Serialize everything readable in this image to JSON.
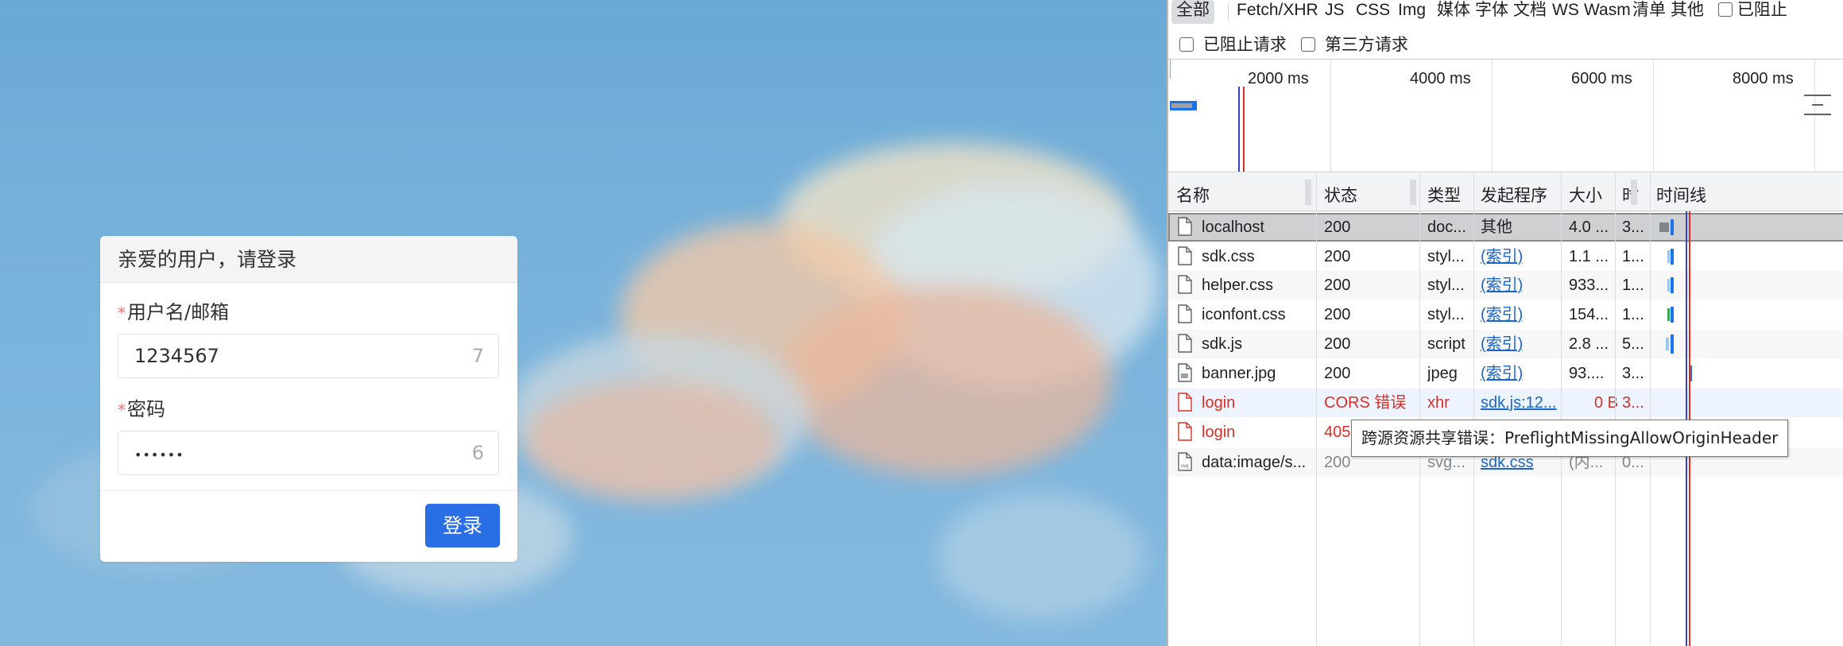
{
  "login": {
    "title": "亲爱的用户，请登录",
    "username_label": "用户名/邮箱",
    "username_value": "1234567",
    "username_count": "7",
    "password_label": "密码",
    "password_value": "••••••",
    "password_count": "6",
    "required_mark": "*",
    "submit_label": "登录"
  },
  "devtools": {
    "filters": [
      "全部",
      "Fetch/XHR",
      "JS",
      "CSS",
      "Img",
      "媒体",
      "字体",
      "文档",
      "WS",
      "Wasm",
      "清单",
      "其他"
    ],
    "blocked_response_cookies": "已阻止",
    "blocked_requests": "已阻止请求",
    "third_party": "第三方请求",
    "timeline_labels": [
      "2000 ms",
      "4000 ms",
      "6000 ms",
      "8000 ms"
    ],
    "columns": [
      "名称",
      "状态",
      "类型",
      "发起程序",
      "大小",
      "时",
      "时间线"
    ],
    "rows": [
      {
        "name": "localhost",
        "status": "200",
        "type": "doc...",
        "initiator": "其他",
        "size": "4.0 ...",
        "time": "3..."
      },
      {
        "name": "sdk.css",
        "status": "200",
        "type": "styl...",
        "initiator": "(索引)",
        "size": "1.1 ...",
        "time": "1..."
      },
      {
        "name": "helper.css",
        "status": "200",
        "type": "styl...",
        "initiator": "(索引)",
        "size": "933...",
        "time": "1..."
      },
      {
        "name": "iconfont.css",
        "status": "200",
        "type": "styl...",
        "initiator": "(索引)",
        "size": "154...",
        "time": "1..."
      },
      {
        "name": "sdk.js",
        "status": "200",
        "type": "script",
        "initiator": "(索引)",
        "size": "2.8 ...",
        "time": "5..."
      },
      {
        "name": "banner.jpg",
        "status": "200",
        "type": "jpeg",
        "initiator": "(索引)",
        "size": "93....",
        "time": "3..."
      },
      {
        "name": "login",
        "status": "CORS 错误",
        "type": "xhr",
        "initiator": "sdk.js:12...",
        "size": "0 B",
        "time": "3..."
      },
      {
        "name": "login",
        "status": "405",
        "type": "",
        "initiator": "",
        "size": "",
        "time": ""
      },
      {
        "name": "data:image/s...",
        "status": "200",
        "type": "svg...",
        "initiator": "sdk.css",
        "size": "(内...",
        "time": "0..."
      }
    ],
    "tooltip": "跨源资源共享错误：PreflightMissingAllowOriginHeader"
  },
  "colors": {
    "accent": "#2a6ee6",
    "error": "#d93025",
    "link": "#1a66c9"
  }
}
